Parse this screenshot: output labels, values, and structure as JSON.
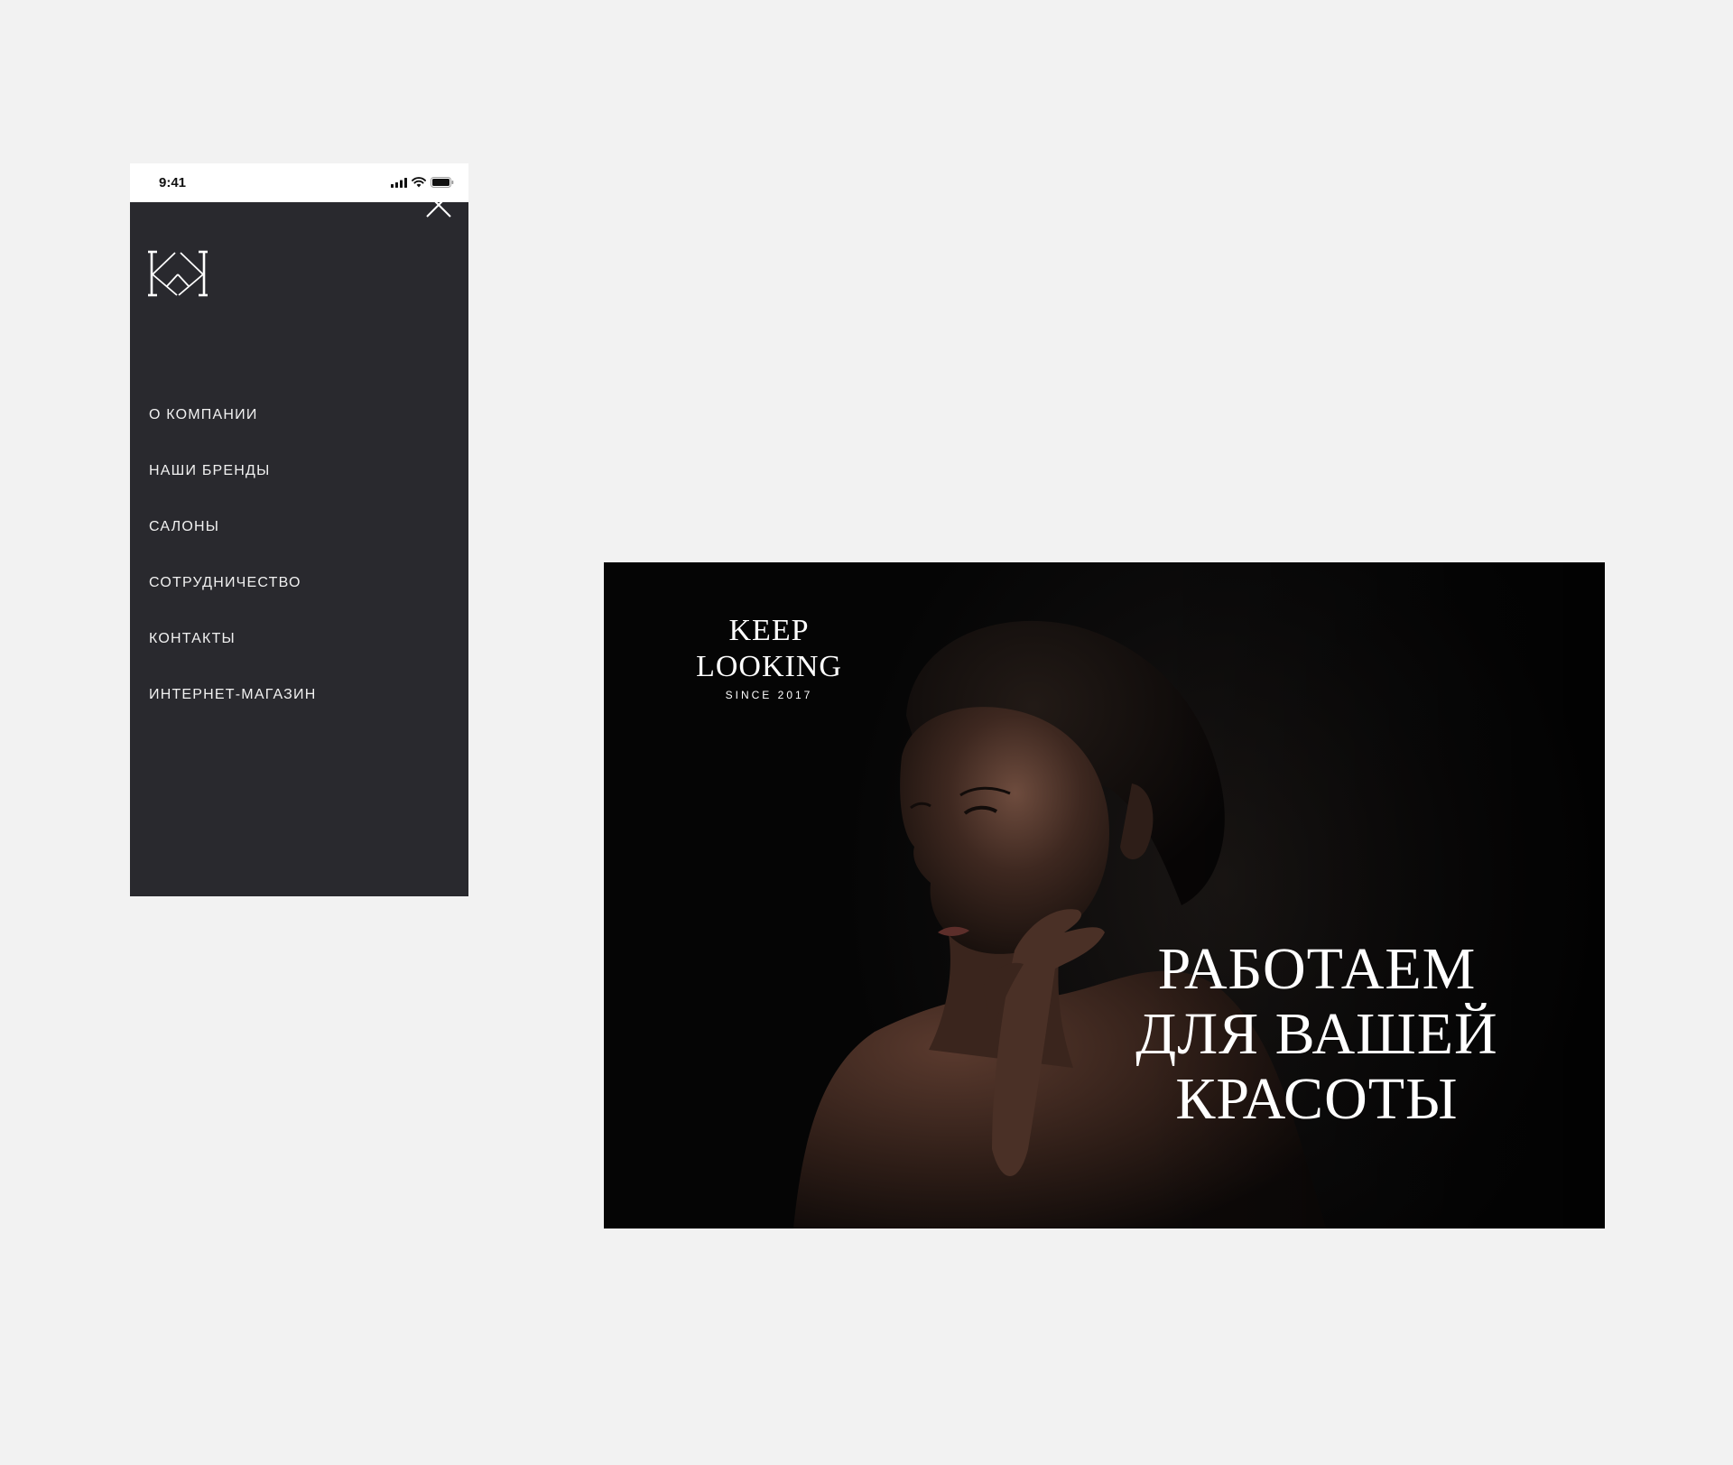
{
  "mobile": {
    "status_bar": {
      "time": "9:41"
    },
    "icons": {
      "close": "close-icon",
      "signal": "cellular-signal-icon",
      "wifi": "wifi-icon",
      "battery": "battery-icon"
    },
    "menu": [
      {
        "label": "О КОМПАНИИ"
      },
      {
        "label": "НАШИ БРЕНДЫ"
      },
      {
        "label": "САЛОНЫ"
      },
      {
        "label": "СОТРУДНИЧЕСТВО"
      },
      {
        "label": "КОНТАКТЫ"
      },
      {
        "label": "ИНТЕРНЕТ-МАГАЗИН"
      }
    ],
    "colors": {
      "menu_background": "#29292e",
      "menu_text": "#f1f1f1"
    }
  },
  "desktop": {
    "brand": {
      "name": "KEEP LOOKING",
      "since": "SINCE 2017"
    },
    "headline": {
      "line1": "РАБОТАЕМ",
      "line2": "ДЛЯ ВАШЕЙ",
      "line3": "КРАСОТЫ"
    },
    "colors": {
      "hero_background": "#0c0b0b",
      "text": "#ffffff"
    }
  }
}
